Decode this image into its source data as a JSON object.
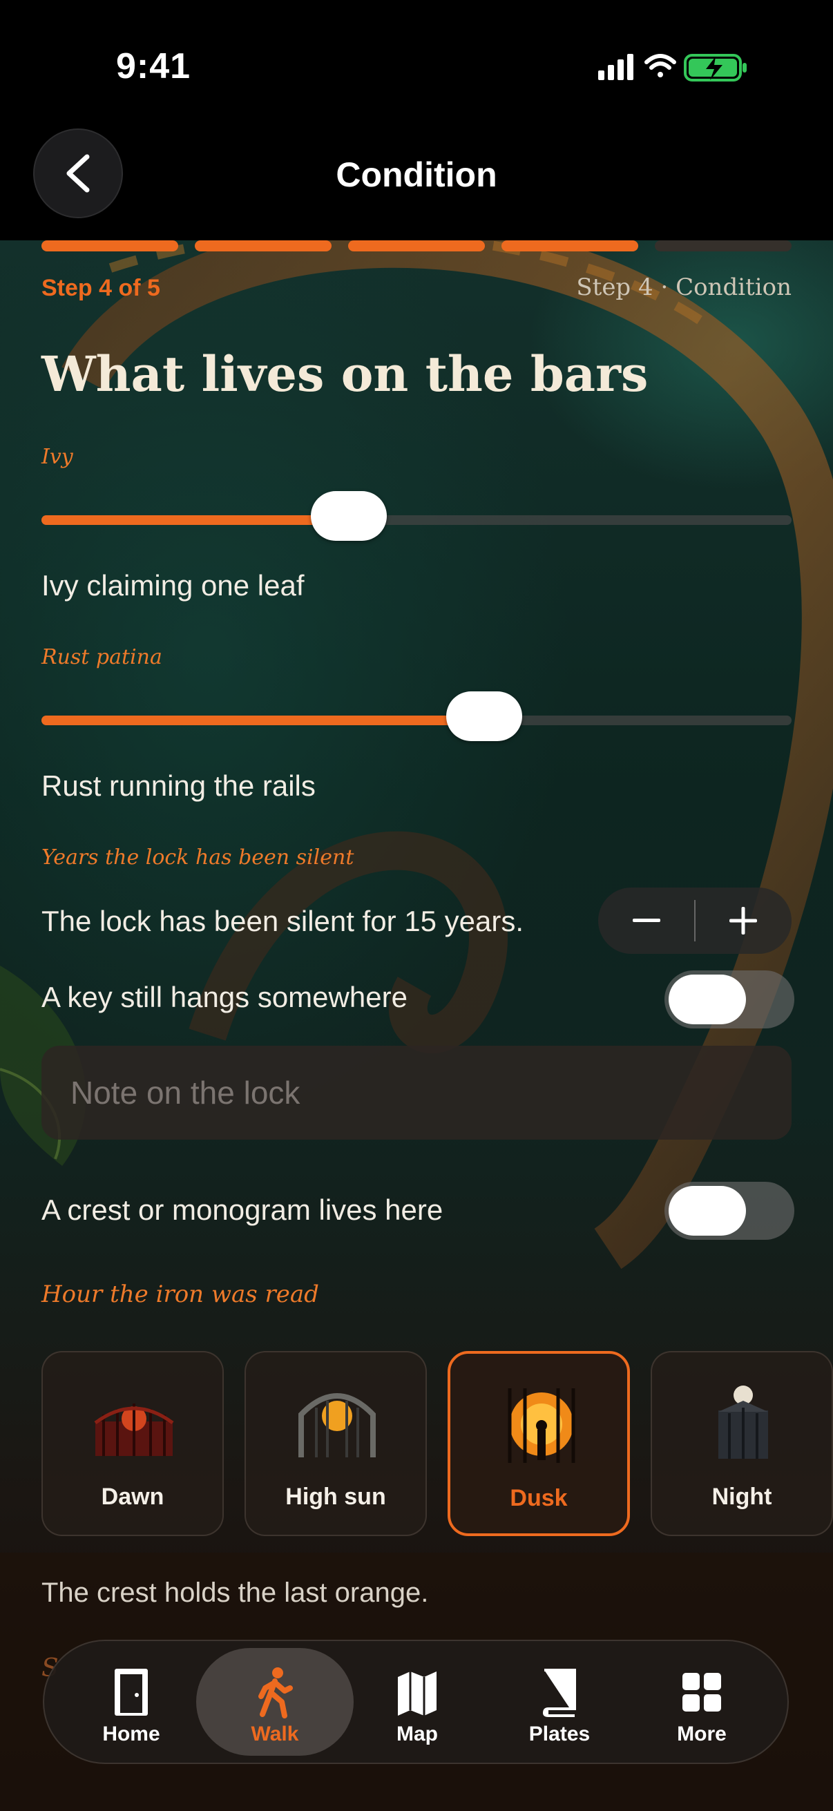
{
  "status": {
    "time": "9:41"
  },
  "header": {
    "title": "Condition"
  },
  "progress": {
    "current_step": 4,
    "total_steps": 5,
    "step_label": "Step 4 of 5",
    "step_title": "Step 4 · Condition"
  },
  "heading": "What lives on the bars",
  "ivy": {
    "label": "Ivy",
    "value": 0.41,
    "caption": "Ivy claiming one leaf"
  },
  "rust": {
    "label": "Rust patina",
    "value": 0.59,
    "caption": "Rust running the rails"
  },
  "lock": {
    "label": "Years the lock has been silent",
    "text": "The lock has been silent for 15 years.",
    "years": 15
  },
  "key_toggle": {
    "label": "A key still hangs somewhere",
    "on": false
  },
  "note": {
    "placeholder": "Note on the lock",
    "value": ""
  },
  "crest_toggle": {
    "label": "A crest or monogram lives here",
    "on": false
  },
  "hour": {
    "label": "Hour the iron was read",
    "options": [
      "Dawn",
      "High sun",
      "Dusk",
      "Night"
    ],
    "selected": "Dusk"
  },
  "footnote": "The crest holds the last orange.",
  "peek_label": "S",
  "tabbar": {
    "items": [
      {
        "label": "Home",
        "icon": "door-icon"
      },
      {
        "label": "Walk",
        "icon": "walking-person-icon"
      },
      {
        "label": "Map",
        "icon": "map-icon"
      },
      {
        "label": "Plates",
        "icon": "book-icon"
      },
      {
        "label": "More",
        "icon": "grid-icon"
      }
    ],
    "active": "Walk"
  },
  "colors": {
    "accent": "#ee6a1f",
    "heading": "#f4ead8",
    "background": "#000000"
  }
}
